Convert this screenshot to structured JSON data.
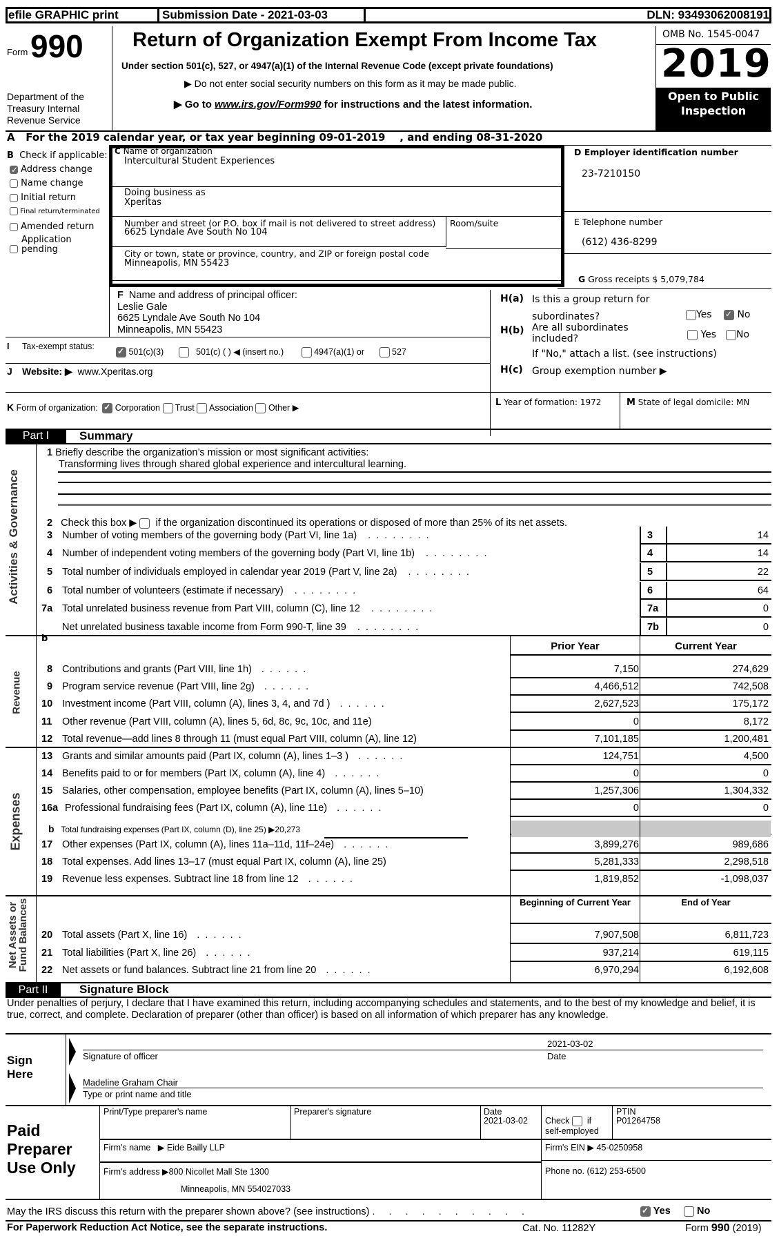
{
  "header": {
    "efile_label": "efile GRAPHIC print",
    "submission_date": "Submission Date - 2021-03-03",
    "dln": "DLN: 93493062008191",
    "form_prefix": "Form",
    "form_number": "990",
    "department": "Department of the Treasury Internal Revenue Service",
    "title": "Return of Organization Exempt From Income Tax",
    "subtitle": "Under section 501(c), 527, or 4947(a)(1) of the Internal Revenue Code (except private foundations)",
    "note_ssn": "▶ Do not enter social security numbers on this form as it may be made public.",
    "note_goto_prefix": "▶ Go to ",
    "note_goto_link": "www.irs.gov/Form990",
    "note_goto_suffix": " for instructions and the latest information.",
    "omb": "OMB No. 1545-0047",
    "year": "2019",
    "open_public": "Open to Public Inspection"
  },
  "line_a": "A   For the 2019 calendar year, or tax year beginning 09-01-2019    , and ending 08-31-2020",
  "section_b": {
    "label_letter": "B",
    "label": "Check if applicable:",
    "items": [
      {
        "label": "Address change",
        "checked": true
      },
      {
        "label": "Name change",
        "checked": false
      },
      {
        "label": "Initial return",
        "checked": false
      },
      {
        "label": "Final return/terminated",
        "checked": false
      },
      {
        "label": "Amended return",
        "checked": false
      },
      {
        "label": "Application pending",
        "checked": false
      }
    ]
  },
  "section_c": {
    "name_label_letter": "C",
    "name_label": "Name of organization",
    "name": "Intercultural Student Experiences",
    "dba_label": "Doing business as",
    "dba": "Xperitas",
    "street_label": "Number and street (or P.O. box if mail is not delivered to street address)",
    "street": "6625 Lyndale Ave South No 104",
    "room_label": "Room/suite",
    "city_label": "City or town, state or province, country, and ZIP or foreign postal code",
    "city": "Minneapolis, MN  55423"
  },
  "section_d": {
    "label": "D Employer identification number",
    "ein": "23-7210150"
  },
  "section_e": {
    "label": "E Telephone number",
    "phone": "(612) 436-8299"
  },
  "section_g": {
    "letter": "G",
    "label": "Gross receipts $ 5,079,784"
  },
  "section_f": {
    "letter": "F",
    "label": "Name and address of principal officer:",
    "name": "Leslie Gale",
    "street": "6625 Lyndale Ave South No 104",
    "city": "Minneapolis, MN  55423"
  },
  "section_h": {
    "ha_label": "H(a)",
    "ha_text1": "Is this a group return for",
    "ha_text2": "subordinates?",
    "ha_yes": "Yes",
    "ha_no": "No",
    "ha_answer": "No",
    "hb_label": "H(b)",
    "hb_text1": "Are all subordinates",
    "hb_text2": "included?",
    "hb_yes": "Yes",
    "hb_no": "No",
    "hb_note": "If \"No,\" attach a list. (see instructions)",
    "hc_label": "H(c)",
    "hc_text": "Group exemption number ▶"
  },
  "section_i": {
    "letter": "I",
    "label": "Tax-exempt status:",
    "options": [
      {
        "label": "501(c)(3)",
        "checked": true
      },
      {
        "label": "501(c) (   ) ◀ (insert no.)",
        "checked": false
      },
      {
        "label": "4947(a)(1) or",
        "checked": false
      },
      {
        "label": "527",
        "checked": false
      }
    ]
  },
  "section_j": {
    "letter": "J",
    "label": "Website: ▶",
    "website": "www.Xperitas.org"
  },
  "section_k": {
    "letter": "K",
    "label": "Form of organization:",
    "options": [
      {
        "label": "Corporation",
        "checked": true
      },
      {
        "label": "Trust",
        "checked": false
      },
      {
        "label": "Association",
        "checked": false
      },
      {
        "label": "Other ▶",
        "checked": false
      }
    ]
  },
  "section_l": {
    "letter": "L",
    "label": "Year of formation: 1972"
  },
  "section_m": {
    "letter": "M",
    "label": "State of legal domicile: MN"
  },
  "part1": {
    "part_label": "Part I",
    "title": "Summary",
    "side_activities": "Activities & Governance",
    "side_revenue": "Revenue",
    "side_expenses": "Expenses",
    "side_netassets_1": "Net Assets or",
    "side_netassets_2": "Fund Balances",
    "line1_num": "1",
    "line1_label": "Briefly describe the organization’s mission or most significant activities:",
    "line1_value": "Transforming lives through shared global experience and intercultural learning.",
    "line2_num": "2",
    "line2_prefix": "Check this box ▶",
    "line2_suffix": "if the organization discontinued its operations or disposed of more than 25% of its net assets.",
    "gov_lines": [
      {
        "num": "3",
        "label": "Number of voting members of the governing body (Part VI, line 1a)",
        "box": "3",
        "value": "14"
      },
      {
        "num": "4",
        "label": "Number of independent voting members of the governing body (Part VI, line 1b)",
        "box": "4",
        "value": "14"
      },
      {
        "num": "5",
        "label": "Total number of individuals employed in calendar year 2019 (Part V, line 2a)",
        "box": "5",
        "value": "22"
      },
      {
        "num": "6",
        "label": "Total number of volunteers (estimate if necessary)",
        "box": "6",
        "value": "64"
      },
      {
        "num": "7a",
        "label": "Total unrelated business revenue from Part VIII, column (C), line 12",
        "box": "7a",
        "value": "0"
      },
      {
        "num": "",
        "label": "Net unrelated business taxable income from Form 990-T, line 39",
        "box": "7b",
        "value": "0"
      }
    ],
    "b_marker": "b",
    "col_prior": "Prior Year",
    "col_current": "Current Year",
    "revenue_lines": [
      {
        "num": "8",
        "label": "Contributions and grants (Part VIII, line 1h)",
        "prior": "7,150",
        "current": "274,629",
        "dots": true
      },
      {
        "num": "9",
        "label": "Program service revenue (Part VIII, line 2g)",
        "prior": "4,466,512",
        "current": "742,508",
        "dots": true
      },
      {
        "num": "10",
        "label": "Investment income (Part VIII, column (A), lines 3, 4, and 7d )",
        "prior": "2,627,523",
        "current": "175,172",
        "dots": true
      },
      {
        "num": "11",
        "label": "Other revenue (Part VIII, column (A), lines 5, 6d, 8c, 9c, 10c, and 11e)",
        "prior": "0",
        "current": "8,172",
        "dots": false
      },
      {
        "num": "12",
        "label": "Total revenue—add lines 8 through 11 (must equal Part VIII, column (A), line 12)",
        "prior": "7,101,185",
        "current": "1,200,481",
        "dots": false
      }
    ],
    "expense_lines": [
      {
        "num": "13",
        "label": "Grants and similar amounts paid (Part IX, column (A), lines 1–3 )",
        "prior": "124,751",
        "current": "4,500",
        "dots": true
      },
      {
        "num": "14",
        "label": "Benefits paid to or for members (Part IX, column (A), line 4)",
        "prior": "0",
        "current": "0",
        "dots": true
      },
      {
        "num": "15",
        "label": "Salaries, other compensation, employee benefits (Part IX, column (A), lines 5–10)",
        "prior": "1,257,306",
        "current": "1,304,332",
        "dots": false
      },
      {
        "num": "16a",
        "label": "Professional fundraising fees (Part IX, column (A), line 11e)",
        "prior": "0",
        "current": "0",
        "dots": true
      }
    ],
    "line16b": {
      "num": "b",
      "label": "Total fundraising expenses (Part IX, column (D), line 25) ▶",
      "value": "20,273"
    },
    "expense_lines2": [
      {
        "num": "17",
        "label": "Other expenses (Part IX, column (A), lines 11a–11d, 11f–24e)",
        "prior": "3,899,276",
        "current": "989,686",
        "dots": true
      },
      {
        "num": "18",
        "label": "Total expenses. Add lines 13–17 (must equal Part IX, column (A), line 25)",
        "prior": "5,281,333",
        "current": "2,298,518",
        "dots": false
      },
      {
        "num": "19",
        "label": "Revenue less expenses. Subtract line 18 from line 12",
        "prior": "1,819,852",
        "current": "-1,098,037",
        "dots": true
      }
    ],
    "col_begin": "Beginning of Current Year",
    "col_end": "End of Year",
    "netasset_lines": [
      {
        "num": "20",
        "label": "Total assets (Part X, line 16)",
        "prior": "7,907,508",
        "current": "6,811,723",
        "dots": true
      },
      {
        "num": "21",
        "label": "Total liabilities (Part X, line 26)",
        "prior": "937,214",
        "current": "619,115",
        "dots": true
      },
      {
        "num": "22",
        "label": "Net assets or fund balances. Subtract line 21 from line 20",
        "prior": "6,970,294",
        "current": "6,192,608",
        "dots": true
      }
    ]
  },
  "part2": {
    "part_label": "Part II",
    "title": "Signature Block",
    "declaration": "Under penalties of perjury, I declare that I have examined this return, including accompanying schedules and statements, and to the best of my knowledge and belief, it is true, correct, and complete. Declaration of preparer (other than officer) is based on all information of which preparer has any knowledge.",
    "sign_here": "Sign Here",
    "sign_date": "2021-03-02",
    "sig_label": "Signature of officer",
    "date_label": "Date",
    "officer_name": "Madeline Graham  Chair",
    "name_title_label": "Type or print name and title"
  },
  "preparer": {
    "heading": "Paid Preparer Use Only",
    "name_label": "Print/Type preparer's name",
    "sig_label": "Preparer's signature",
    "date_label": "Date",
    "date": "2021-03-02",
    "check_label_1": "Check",
    "check_label_2": "if",
    "check_label_3": "self-employed",
    "ptin_label": "PTIN",
    "ptin": "P01264758",
    "firm_name_label": "Firm's name   ▶",
    "firm_name": "Eide Bailly LLP",
    "firm_ein_label": "Firm's EIN ▶",
    "firm_ein": "45-0250958",
    "firm_address_label": "Firm's address ▶",
    "firm_address_1": "800 Nicollet Mall Ste 1300",
    "firm_address_2": "Minneapolis, MN  554027033",
    "phone_label": "Phone no.",
    "phone": "(612) 253-6500"
  },
  "footer": {
    "discuss_question": "May the IRS discuss this return with the preparer shown above? (see instructions)",
    "discuss_yes": "Yes",
    "discuss_no": "No",
    "discuss_answer": "Yes",
    "paperwork": "For Paperwork Reduction Act Notice, see the separate instructions.",
    "cat_no": "Cat. No. 11282Y",
    "form_label": "Form",
    "form_number": "990",
    "form_year": "(2019)"
  }
}
